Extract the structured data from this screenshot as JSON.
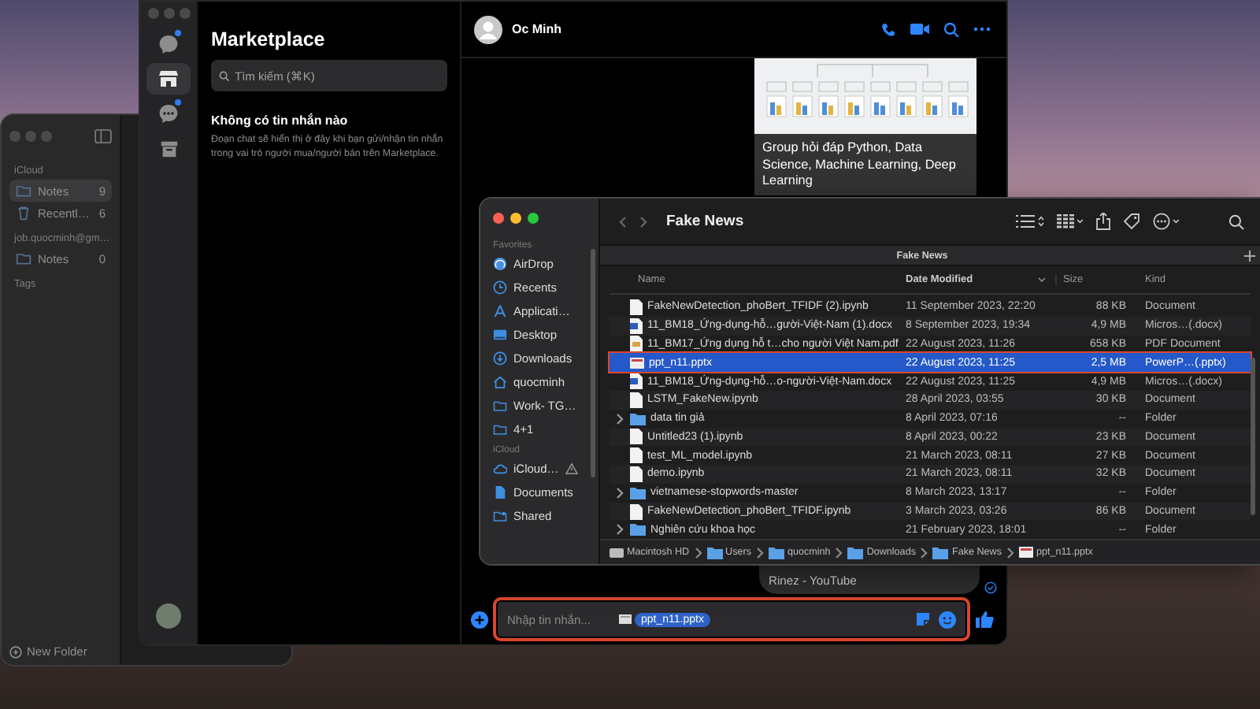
{
  "notes": {
    "sections": [
      {
        "heading": "iCloud",
        "folders": [
          {
            "kind": "folder",
            "name": "Notes",
            "count": "9",
            "selected": true
          },
          {
            "kind": "trash",
            "name": "Recentl…",
            "count": "6",
            "selected": false
          }
        ]
      },
      {
        "heading": "job.quocminh@gm…",
        "folders": [
          {
            "kind": "folder",
            "name": "Notes",
            "count": "0",
            "selected": false
          }
        ]
      }
    ],
    "tags_heading": "Tags",
    "new_folder": "New Folder"
  },
  "messenger": {
    "rail": [
      {
        "kind": "chats",
        "badge": true,
        "selected": false
      },
      {
        "kind": "marketplace",
        "badge": false,
        "selected": true
      },
      {
        "kind": "requests",
        "badge": true,
        "selected": false
      },
      {
        "kind": "archive",
        "badge": false,
        "selected": false
      }
    ],
    "panel_title": "Marketplace",
    "search": {
      "placeholder": "Tìm kiếm (⌘K)"
    },
    "empty_title": "Không có tin nhắn nào",
    "empty_text": "Đoạn chat sẽ hiển thị ở đây khi bạn gửi/nhận tin nhắn trong vai trò người mua/người bán trên Marketplace.",
    "chat": {
      "contact": "Oc Minh",
      "link_preview": {
        "title": "Group hỏi đáp Python, Data Science, Machine Learning, Deep Learning"
      },
      "message": "Rinez - YouTube",
      "composer": {
        "placeholder": "Nhập tin nhắn...",
        "attachment": "ppt_n11.pptx",
        "highlighted": true
      }
    }
  },
  "finder": {
    "title": "Fake News",
    "tab": "Fake News",
    "sidebar": [
      {
        "heading": "Favorites",
        "items": [
          {
            "kind": "airdrop",
            "label": "AirDrop",
            "warning": false
          },
          {
            "kind": "recents",
            "label": "Recents",
            "warning": false
          },
          {
            "kind": "apps",
            "label": "Applicati…",
            "warning": false
          },
          {
            "kind": "desktop",
            "label": "Desktop",
            "warning": false
          },
          {
            "kind": "downloads",
            "label": "Downloads",
            "warning": false
          },
          {
            "kind": "home",
            "label": "quocminh",
            "warning": false
          },
          {
            "kind": "folder",
            "label": "Work- TG…",
            "warning": false
          },
          {
            "kind": "folder",
            "label": "4+1",
            "warning": false
          }
        ]
      },
      {
        "heading": "iCloud",
        "items": [
          {
            "kind": "cloud",
            "label": "iCloud…",
            "warning": true
          },
          {
            "kind": "document",
            "label": "Documents",
            "warning": false
          },
          {
            "kind": "shared",
            "label": "Shared",
            "warning": false
          }
        ]
      }
    ],
    "columns": [
      "Name",
      "Date Modified",
      "Size",
      "Kind"
    ],
    "rows": [
      {
        "kind": "document",
        "name": "FakeNewDetection_phoBert_TFIDF (2).ipynb",
        "date": "11 September 2023, 22:20",
        "size": "88 KB",
        "type": "Document",
        "selected": false,
        "highlighted": false
      },
      {
        "kind": "word",
        "name": "11_BM18_Ứng-dụng-hỗ…gười-Việt-Nam (1).docx",
        "date": "8 September 2023, 19:34",
        "size": "4,9 MB",
        "type": "Micros…(.docx)",
        "selected": false,
        "highlighted": false
      },
      {
        "kind": "pdf",
        "name": "11_BM17_Ứng dụng hỗ t…cho người Việt Nam.pdf",
        "date": "22 August 2023, 11:26",
        "size": "658 KB",
        "type": "PDF Document",
        "selected": false,
        "highlighted": false
      },
      {
        "kind": "powerpoint",
        "name": "ppt_n11.pptx",
        "date": "22 August 2023, 11:25",
        "size": "2,5 MB",
        "type": "PowerP…(.pptx)",
        "selected": true,
        "highlighted": true
      },
      {
        "kind": "word",
        "name": "11_BM18_Ứng-dụng-hỗ…o-người-Việt-Nam.docx",
        "date": "22 August 2023, 11:25",
        "size": "4,9 MB",
        "type": "Micros…(.docx)",
        "selected": false,
        "highlighted": false
      },
      {
        "kind": "document",
        "name": "LSTM_FakeNew.ipynb",
        "date": "28 April 2023, 03:55",
        "size": "30 KB",
        "type": "Document",
        "selected": false,
        "highlighted": false
      },
      {
        "kind": "folder",
        "name": "data tin giả",
        "date": "8 April 2023, 07:16",
        "size": "--",
        "type": "Folder",
        "selected": false,
        "highlighted": false
      },
      {
        "kind": "document",
        "name": "Untitled23 (1).ipynb",
        "date": "8 April 2023, 00:22",
        "size": "23 KB",
        "type": "Document",
        "selected": false,
        "highlighted": false
      },
      {
        "kind": "document",
        "name": "test_ML_model.ipynb",
        "date": "21 March 2023, 08:11",
        "size": "27 KB",
        "type": "Document",
        "selected": false,
        "highlighted": false
      },
      {
        "kind": "document",
        "name": "demo.ipynb",
        "date": "21 March 2023, 08:11",
        "size": "32 KB",
        "type": "Document",
        "selected": false,
        "highlighted": false
      },
      {
        "kind": "folder",
        "name": "vietnamese-stopwords-master",
        "date": "8 March 2023, 13:17",
        "size": "--",
        "type": "Folder",
        "selected": false,
        "highlighted": false
      },
      {
        "kind": "document",
        "name": "FakeNewDetection_phoBert_TFIDF.ipynb",
        "date": "3 March 2023, 03:26",
        "size": "86 KB",
        "type": "Document",
        "selected": false,
        "highlighted": false
      },
      {
        "kind": "folder",
        "name": "Nghiên cứu khoa học",
        "date": "21 February 2023, 18:01",
        "size": "--",
        "type": "Folder",
        "selected": false,
        "highlighted": false
      }
    ],
    "path": [
      {
        "kind": "disk",
        "label": "Macintosh HD"
      },
      {
        "kind": "folder",
        "label": "Users"
      },
      {
        "kind": "folder",
        "label": "quocminh"
      },
      {
        "kind": "folder",
        "label": "Downloads"
      },
      {
        "kind": "folder",
        "label": "Fake News"
      },
      {
        "kind": "powerpoint",
        "label": "ppt_n11.pptx"
      }
    ]
  }
}
